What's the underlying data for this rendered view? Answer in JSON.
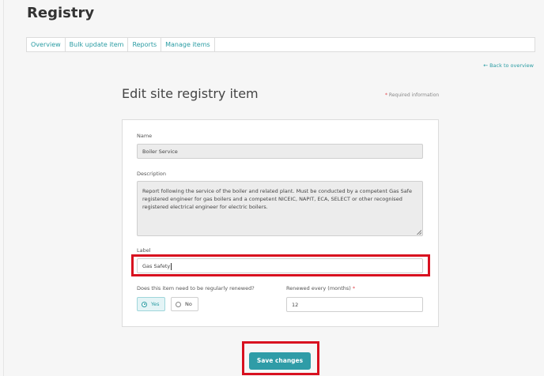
{
  "page": {
    "title": "Registry"
  },
  "tabs": [
    "Overview",
    "Bulk update item",
    "Reports",
    "Manage items"
  ],
  "back_link": "Back to overview",
  "form": {
    "heading": "Edit site registry item",
    "required_prefix": "*",
    "required_text": "Required information",
    "name_label": "Name",
    "name_value": "Boiler Service",
    "description_label": "Description",
    "description_value": "Report following the service of the boiler and related plant.  Must be conducted by a competent Gas Safe registered engineer for gas boilers and a competent NICEIC, NAPIT, ECA, SELECT or other recognised registered electrical engineer for electric boilers.",
    "label_label": "Label",
    "label_value": "Gas Safety",
    "renew_question": "Does this item need to be regularly renewed?",
    "yes_label": "Yes",
    "no_label": "No",
    "selected_option": "Yes",
    "renewed_label": "Renewed every (months)",
    "renewed_required": "*",
    "renewed_value": "12",
    "save_label": "Save changes"
  },
  "colors": {
    "accent": "#2f9ca7",
    "highlight": "#d8101f",
    "required": "#e2434b"
  }
}
